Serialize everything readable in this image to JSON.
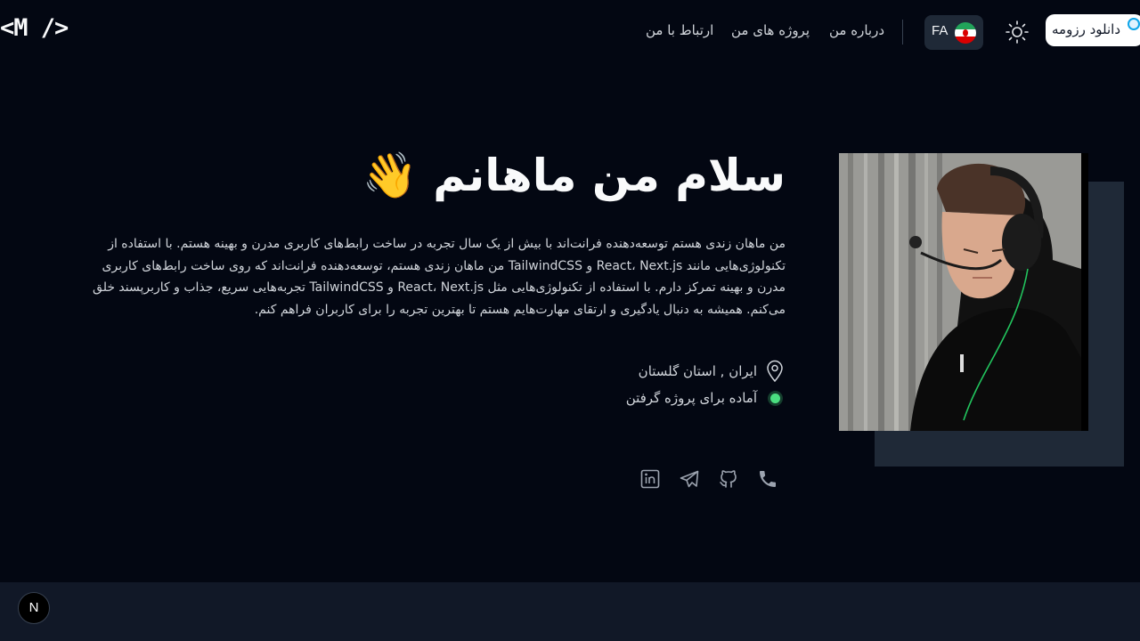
{
  "logo": "<M />",
  "nav": {
    "links": [
      "ارتباط با من",
      "پروژه های من",
      "درباره من"
    ],
    "lang": "FA",
    "resume": "دانلود رزومه"
  },
  "hero": {
    "title": "سلام من ماهانم 👋",
    "description": "من ماهان زندی هستم توسعه‌دهنده فرانت‌اند با بیش از یک سال تجربه در ساخت رابط‌های کاربری مدرن و بهینه هستم. با استفاده از تکنولوژی‌هایی مانند React، Next.js و TailwindCSS من ماهان زندی هستم، توسعه‌دهنده فرانت‌اند که روی ساخت رابط‌های کاربری مدرن و بهینه تمرکز دارم. با استفاده از تکنولوژی‌هایی مثل React، Next.js و TailwindCSS تجربه‌هایی سریع، جذاب و کاربرپسند خلق می‌کنم. همیشه به دنبال یادگیری و ارتقای مهارت‌هایم هستم تا بهترین تجربه را برای کاربران فراهم کنم.",
    "location": "ایران , استان گلستان",
    "status": "آماده برای پروژه گرفتن"
  },
  "social": [
    "phone-icon",
    "github-icon",
    "telegram-icon",
    "linkedin-icon"
  ],
  "footer": {
    "badge": "N"
  },
  "colors": {
    "background": "#030712",
    "status": "#4ade80",
    "card": "#1f2937"
  }
}
